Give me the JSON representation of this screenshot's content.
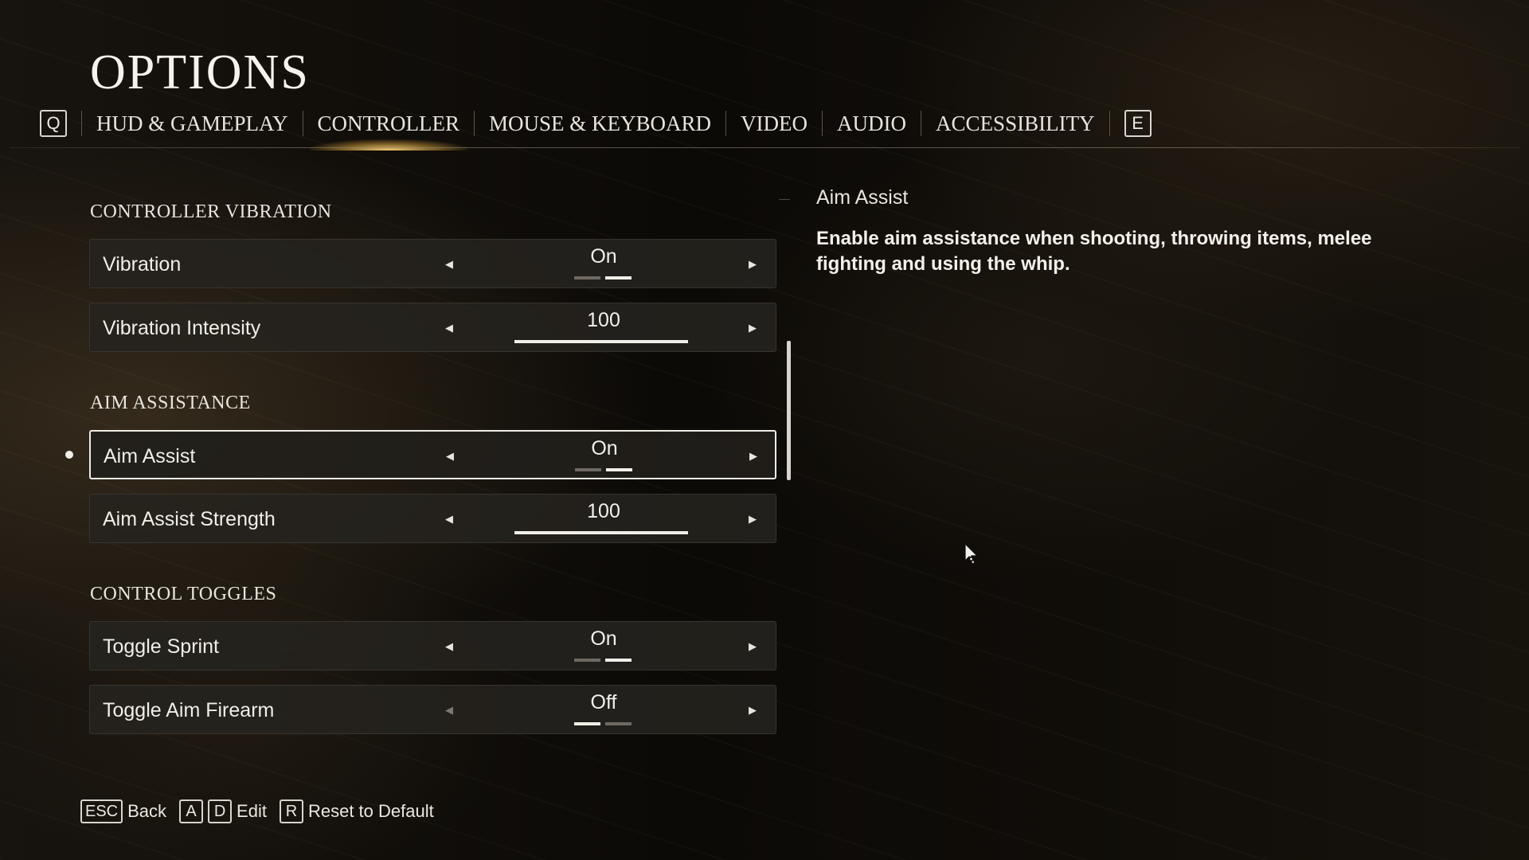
{
  "header": {
    "title": "OPTIONS"
  },
  "tabs": {
    "prev_key": "Q",
    "next_key": "E",
    "items": [
      {
        "label": "HUD & GAMEPLAY",
        "active": false
      },
      {
        "label": "CONTROLLER",
        "active": true
      },
      {
        "label": "MOUSE & KEYBOARD",
        "active": false
      },
      {
        "label": "VIDEO",
        "active": false
      },
      {
        "label": "AUDIO",
        "active": false
      },
      {
        "label": "ACCESSIBILITY",
        "active": false
      }
    ]
  },
  "sections": [
    {
      "title": "CONTROLLER VIBRATION",
      "settings": [
        {
          "label": "Vibration",
          "type": "toggle",
          "value": "On",
          "state": "on",
          "left_enabled": true
        },
        {
          "label": "Vibration Intensity",
          "type": "slider",
          "value": "100",
          "level": 1.0,
          "left_enabled": true
        }
      ]
    },
    {
      "title": "AIM ASSISTANCE",
      "settings": [
        {
          "label": "Aim Assist",
          "type": "toggle",
          "value": "On",
          "state": "on",
          "selected": true,
          "left_enabled": true
        },
        {
          "label": "Aim Assist Strength",
          "type": "slider",
          "value": "100",
          "level": 1.0,
          "left_enabled": true
        }
      ]
    },
    {
      "title": "CONTROL TOGGLES",
      "settings": [
        {
          "label": "Toggle Sprint",
          "type": "toggle",
          "value": "On",
          "state": "on",
          "left_enabled": true
        },
        {
          "label": "Toggle Aim Firearm",
          "type": "toggle",
          "value": "Off",
          "state": "off",
          "left_enabled": false
        }
      ]
    }
  ],
  "description": {
    "title": "Aim Assist",
    "body": "Enable aim assistance when shooting, throwing items, melee fighting and using the whip."
  },
  "footer": {
    "back_key": "ESC",
    "back_label": "Back",
    "edit_key_a": "A",
    "edit_key_d": "D",
    "edit_label": "Edit",
    "reset_key": "R",
    "reset_label": "Reset to Default"
  },
  "colors": {
    "accent_glow": "#f0c060",
    "text": "#f2f0ea",
    "row_bg": "#26231f",
    "indicator_on": "#f2efe9",
    "indicator_off": "#6e6a63"
  },
  "icons": {
    "left_arrow": "caret-left-icon",
    "right_arrow": "caret-right-icon",
    "cursor": "mouse-pointer-icon"
  }
}
